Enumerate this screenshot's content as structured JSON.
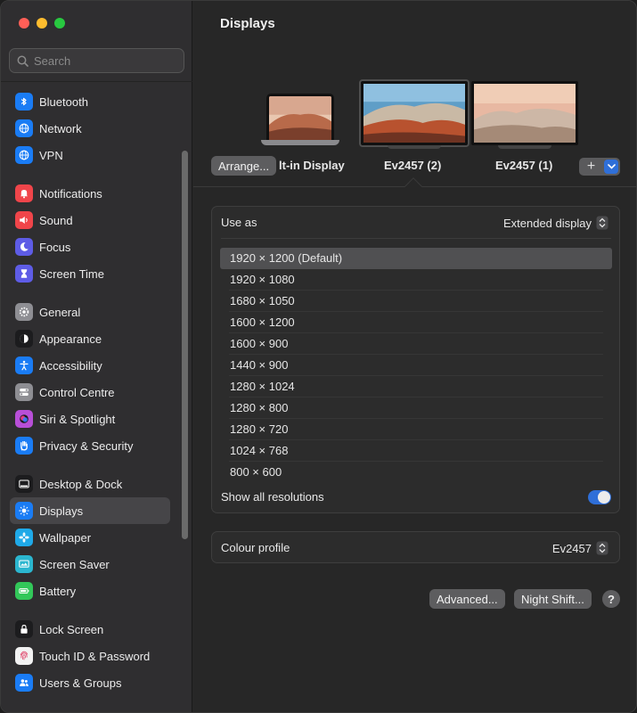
{
  "window": {
    "title": "Displays"
  },
  "search": {
    "placeholder": "Search"
  },
  "sidebar": {
    "groups": [
      [
        {
          "label": "Bluetooth",
          "icon": "bluetooth-icon",
          "color": "#1a7cf5"
        },
        {
          "label": "Network",
          "icon": "globe-icon",
          "color": "#1a7cf5"
        },
        {
          "label": "VPN",
          "icon": "globe-icon",
          "color": "#1a7cf5"
        }
      ],
      [
        {
          "label": "Notifications",
          "icon": "bell-icon",
          "color": "#f0454a"
        },
        {
          "label": "Sound",
          "icon": "speaker-icon",
          "color": "#f0454a"
        },
        {
          "label": "Focus",
          "icon": "moon-icon",
          "color": "#5e5ce6"
        },
        {
          "label": "Screen Time",
          "icon": "hourglass-icon",
          "color": "#5e5ce6"
        }
      ],
      [
        {
          "label": "General",
          "icon": "gear-icon",
          "color": "#8e8e93"
        },
        {
          "label": "Appearance",
          "icon": "appearance-icon",
          "color": "#1c1c1e"
        },
        {
          "label": "Accessibility",
          "icon": "accessibility-icon",
          "color": "#1a7cf5"
        },
        {
          "label": "Control Centre",
          "icon": "toggles-icon",
          "color": "#8e8e93"
        },
        {
          "label": "Siri & Spotlight",
          "icon": "siri-icon",
          "color": "#b84fd8"
        },
        {
          "label": "Privacy & Security",
          "icon": "hand-icon",
          "color": "#1a7cf5"
        }
      ],
      [
        {
          "label": "Desktop & Dock",
          "icon": "dock-icon",
          "color": "#1c1c1e"
        },
        {
          "label": "Displays",
          "icon": "sun-icon",
          "color": "#1a7cf5",
          "active": true
        },
        {
          "label": "Wallpaper",
          "icon": "flower-icon",
          "color": "#1fa9e8"
        },
        {
          "label": "Screen Saver",
          "icon": "screensaver-icon",
          "color": "#2bb6cf"
        },
        {
          "label": "Battery",
          "icon": "battery-icon",
          "color": "#32c759"
        }
      ],
      [
        {
          "label": "Lock Screen",
          "icon": "lock-icon",
          "color": "#1c1c1e"
        },
        {
          "label": "Touch ID & Password",
          "icon": "fingerprint-icon",
          "color": "#f2f2f2"
        },
        {
          "label": "Users & Groups",
          "icon": "users-icon",
          "color": "#1a7cf5"
        }
      ]
    ]
  },
  "displays": {
    "arrange_label": "Arrange...",
    "builtin_label": "lt-in Display",
    "mon2_label": "Ev2457 (2)",
    "mon1_label": "Ev2457 (1)",
    "add_label": "+"
  },
  "settings": {
    "use_as_label": "Use as",
    "use_as_value": "Extended display",
    "resolutions": [
      "1920 × 1200 (Default)",
      "1920 × 1080",
      "1680 × 1050",
      "1600 × 1200",
      "1600 × 900",
      "1440 × 900",
      "1280 × 1024",
      "1280 × 800",
      "1280 × 720",
      "1024 × 768",
      "800 × 600"
    ],
    "selected_resolution": 0,
    "show_all_label": "Show all resolutions",
    "show_all_on": true,
    "colour_profile_label": "Colour profile",
    "colour_profile_value": "Ev2457"
  },
  "buttons": {
    "advanced": "Advanced...",
    "night_shift": "Night Shift...",
    "help": "?"
  },
  "colors": {
    "accent": "#2f6fd8"
  }
}
